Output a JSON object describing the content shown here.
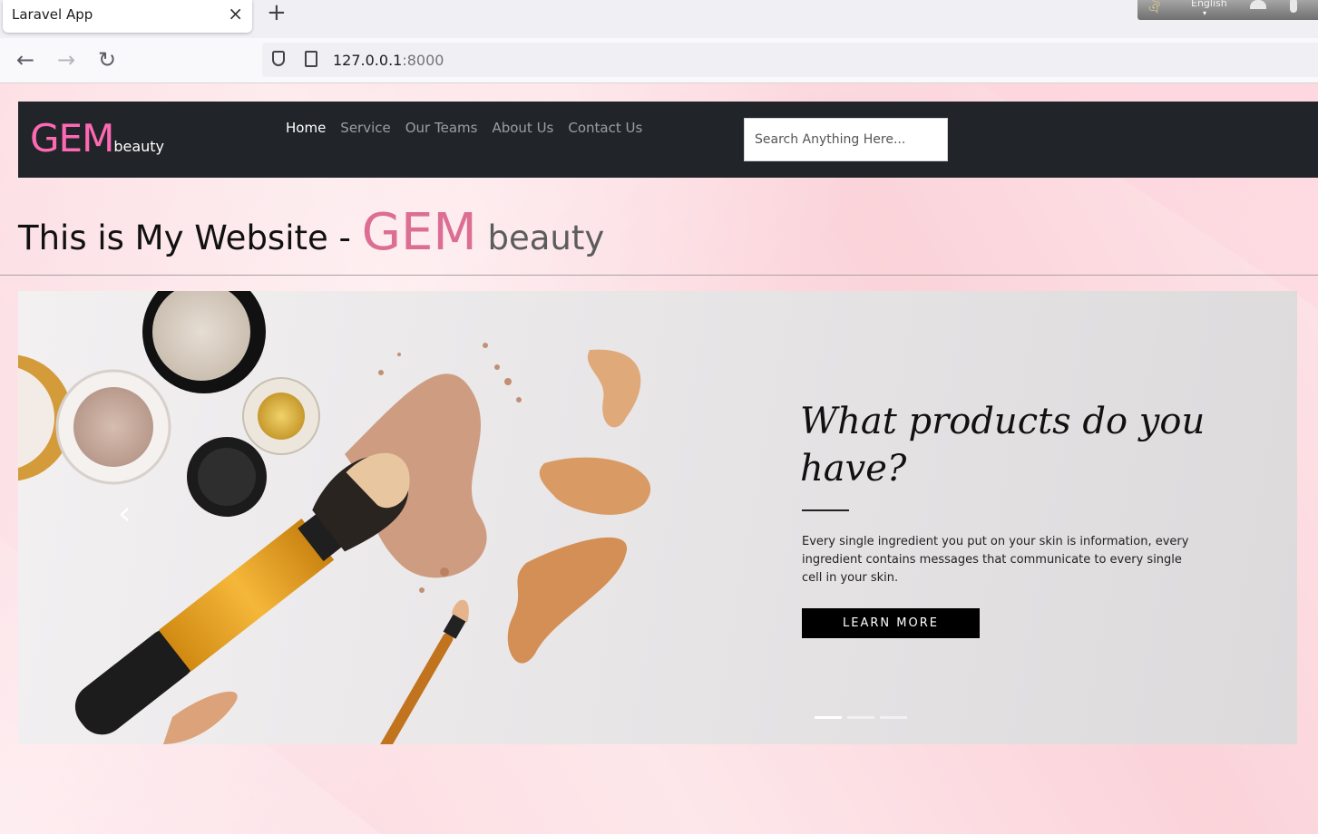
{
  "browser": {
    "tab_title": "Laravel App",
    "tab_close_icon": "×",
    "new_tab_icon": "+",
    "back_icon": "←",
    "forward_icon": "→",
    "reload_icon": "↻",
    "url_host": "127.0.0.1",
    "url_port": ":8000",
    "lang_widget_label": "English",
    "lang_caret": "▾"
  },
  "site": {
    "brand_gem": "GEM",
    "brand_beauty": "beauty",
    "menu": [
      {
        "label": "Home",
        "active": true
      },
      {
        "label": "Service"
      },
      {
        "label": "Our Teams"
      },
      {
        "label": "About Us"
      },
      {
        "label": "Contact Us"
      }
    ],
    "search_placeholder": "Search Anything Here...",
    "headline_main": "This is My Website - ",
    "headline_gem": "GEM",
    "headline_beauty": " beauty"
  },
  "carousel": {
    "prev_icon": "‹",
    "title": "What products do you have?",
    "text": "Every single ingredient you put on your skin is information, every ingredient contains messages that communicate to every single cell in your skin.",
    "button_label": "LEARN MORE",
    "active_indicator": 1,
    "indicator_count": 3
  },
  "colors": {
    "brand_pink": "#ff69b4",
    "headline_pink": "#dc6e94",
    "navbar_bg": "#212529",
    "page_bg": "#fde4e8"
  }
}
